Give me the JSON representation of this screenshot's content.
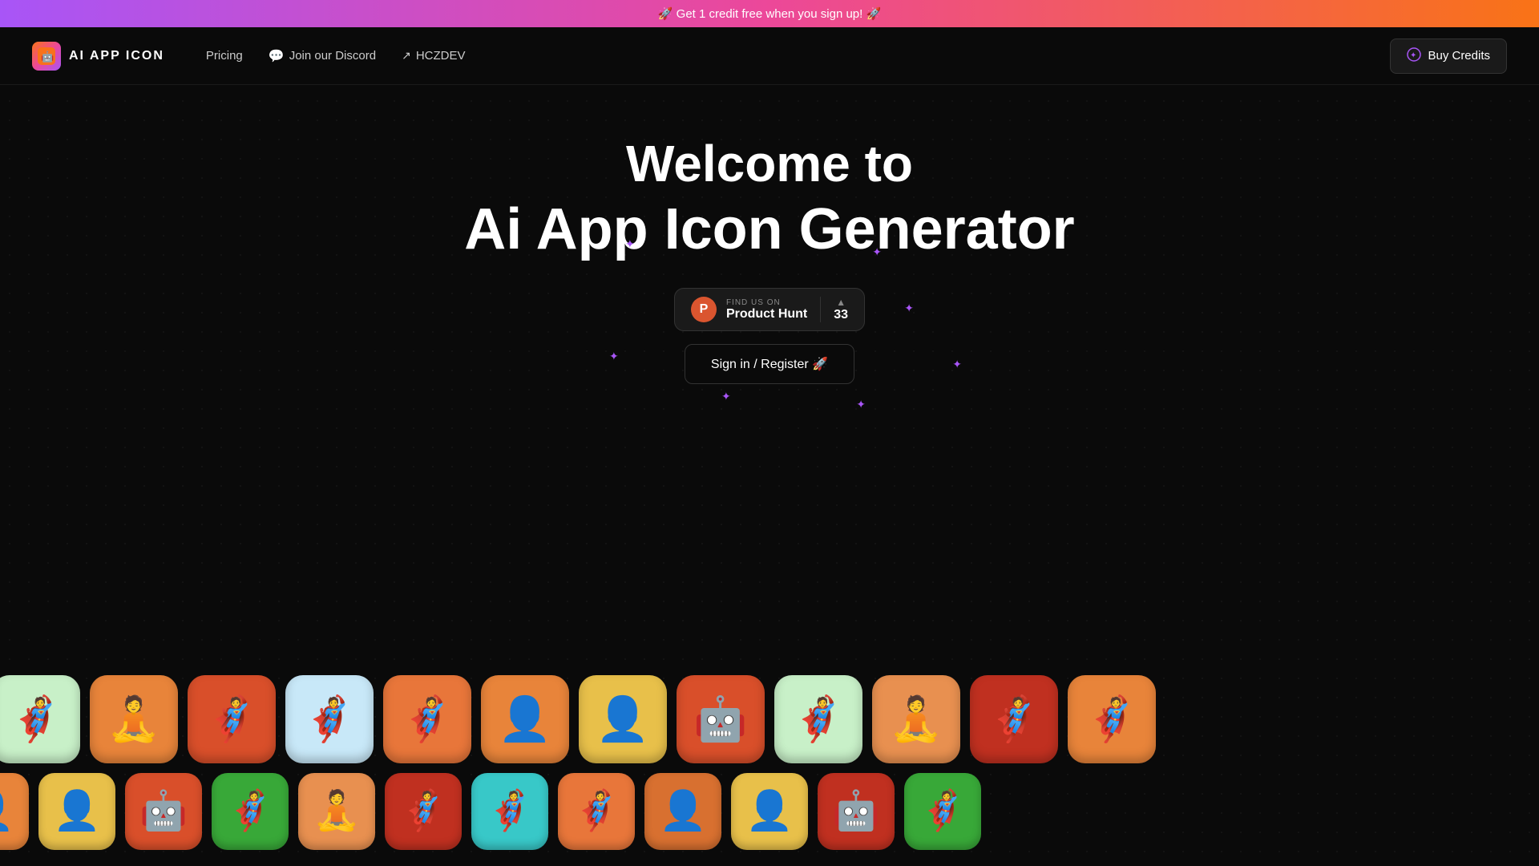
{
  "banner": {
    "text": "🚀 Get 1 credit free when you sign up! 🚀"
  },
  "navbar": {
    "logo_text": "AI APP ICON",
    "logo_emoji": "🤖",
    "pricing_label": "Pricing",
    "discord_label": "Join our Discord",
    "hczdev_label": "HCZDEV",
    "buy_credits_label": "Buy Credits"
  },
  "hero": {
    "line1": "Welcome to",
    "line2": "Ai App Icon Generator",
    "product_hunt_find": "FIND US ON",
    "product_hunt_name": "Product Hunt",
    "product_hunt_votes": "33",
    "signin_label": "Sign in / Register 🚀"
  },
  "icons_row1": [
    {
      "emoji": "🦸",
      "bg": "bg-green-light"
    },
    {
      "emoji": "🧘",
      "bg": "bg-orange"
    },
    {
      "emoji": "🦸",
      "bg": "bg-red-orange"
    },
    {
      "emoji": "🦸",
      "bg": "bg-blue-light"
    },
    {
      "emoji": "🦸",
      "bg": "bg-orange-warm"
    },
    {
      "emoji": "👤",
      "bg": "bg-orange"
    },
    {
      "emoji": "👤",
      "bg": "bg-yellow"
    },
    {
      "emoji": "🤖",
      "bg": "bg-red-orange"
    },
    {
      "emoji": "🦸",
      "bg": "bg-green-light"
    },
    {
      "emoji": "🧘",
      "bg": "bg-orange-light"
    },
    {
      "emoji": "🦸",
      "bg": "bg-dark-red"
    },
    {
      "emoji": "🦸",
      "bg": "bg-orange"
    }
  ],
  "icons_row2": [
    {
      "emoji": "👤",
      "bg": "bg-orange"
    },
    {
      "emoji": "👤",
      "bg": "bg-yellow"
    },
    {
      "emoji": "🤖",
      "bg": "bg-red-orange"
    },
    {
      "emoji": "🦸",
      "bg": "bg-green"
    },
    {
      "emoji": "🧘",
      "bg": "bg-orange-light"
    },
    {
      "emoji": "🦸",
      "bg": "bg-dark-red"
    },
    {
      "emoji": "🦸",
      "bg": "bg-teal"
    },
    {
      "emoji": "🦸",
      "bg": "bg-orange-warm"
    },
    {
      "emoji": "👤",
      "bg": "bg-orange2"
    },
    {
      "emoji": "👤",
      "bg": "bg-yellow"
    },
    {
      "emoji": "🤖",
      "bg": "bg-dark-red"
    },
    {
      "emoji": "🦸",
      "bg": "bg-green"
    }
  ]
}
